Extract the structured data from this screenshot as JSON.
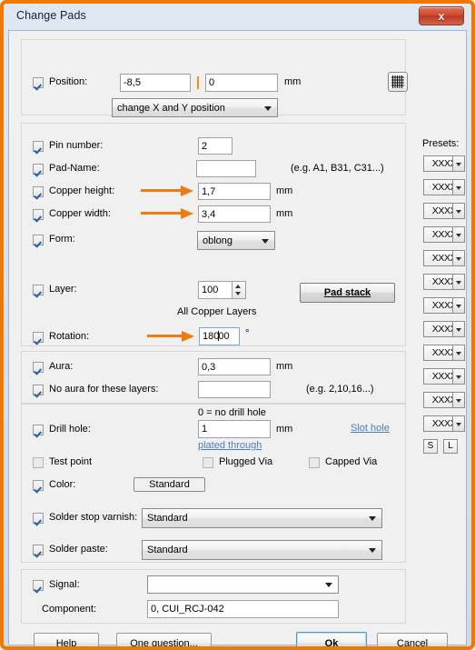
{
  "window": {
    "title": "Change Pads",
    "close_label": "x",
    "border_color": "#f07800",
    "accent_color": "#f2790b"
  },
  "position_group": {
    "checkbox_label": "Position:",
    "checked": true,
    "x_value": "-8,5",
    "y_value": "0",
    "unit": "mm",
    "mode_select": "change X and Y position",
    "grid_icon": "grid-icon"
  },
  "pad_group": {
    "pin_number": {
      "label": "Pin number:",
      "checked": true,
      "value": "2"
    },
    "pad_name": {
      "label": "Pad-Name:",
      "checked": true,
      "value": "",
      "hint": "(e.g. A1, B31, C31...)"
    },
    "copper_height": {
      "label": "Copper height:",
      "checked": true,
      "value": "1,7",
      "unit": "mm"
    },
    "copper_width": {
      "label": "Copper width:",
      "checked": true,
      "value": "3,4",
      "unit": "mm"
    },
    "form": {
      "label": "Form:",
      "checked": true,
      "value": "oblong"
    },
    "layer": {
      "label": "Layer:",
      "checked": true,
      "value": "100",
      "sub_label": "All Copper Layers"
    },
    "pad_stack_button": "Pad stack",
    "rotation": {
      "label": "Rotation:",
      "checked": true,
      "value_before_caret": "180",
      "value_after_caret": "00",
      "unit": "°"
    }
  },
  "aura_group": {
    "aura": {
      "label": "Aura:",
      "checked": true,
      "value": "0,3",
      "unit": "mm"
    },
    "no_aura": {
      "label": "No aura for these layers:",
      "checked": true,
      "value": "",
      "hint": "(e.g. 2,10,16...)"
    }
  },
  "drill_group": {
    "note": "0 = no drill hole",
    "drill_hole": {
      "label": "Drill hole:",
      "checked": true,
      "value": "1",
      "unit": "mm"
    },
    "plated_through_link": "plated through",
    "slot_hole_link": "Slot hole",
    "test_point": {
      "label": "Test point",
      "checked": false
    },
    "plugged_via": {
      "label": "Plugged Via",
      "checked": false
    },
    "capped_via": {
      "label": "Capped Via",
      "checked": false
    },
    "color": {
      "label": "Color:",
      "checked": true,
      "button": "Standard"
    },
    "solder_stop_varnish": {
      "label": "Solder stop varnish:",
      "checked": true,
      "value": "Standard"
    },
    "solder_paste": {
      "label": "Solder paste:",
      "checked": true,
      "value": "Standard"
    }
  },
  "signal_group": {
    "signal": {
      "label": "Signal:",
      "checked": true,
      "value": ""
    },
    "component": {
      "label": "Component:",
      "value": "0, CUI_RCJ-042"
    }
  },
  "presets": {
    "label": "Presets:",
    "items": [
      {
        "label": "XXXX"
      },
      {
        "label": "XXXX"
      },
      {
        "label": "XXXX"
      },
      {
        "label": "XXXX"
      },
      {
        "label": "XXXX"
      },
      {
        "label": "XXXX"
      },
      {
        "label": "XXXX"
      },
      {
        "label": "XXXX"
      },
      {
        "label": "XXXX"
      },
      {
        "label": "XXXX"
      },
      {
        "label": "XXXX"
      },
      {
        "label": "XXXX"
      }
    ],
    "save_button": "S",
    "load_button": "L"
  },
  "footer": {
    "help": "Help",
    "one_question": "One question...",
    "ok": "Ok",
    "cancel": "Cancel"
  }
}
